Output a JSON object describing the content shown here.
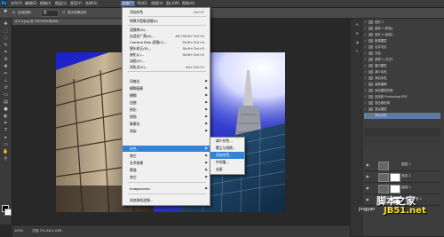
{
  "menubar": {
    "logo": "Ps",
    "items": [
      "文件(F)",
      "编辑(E)",
      "图像(I)",
      "图层(L)",
      "类型(Y)",
      "选择(S)",
      "滤镜(T)",
      "3D(D)",
      "视图(V)",
      "窗口(W)",
      "帮助(H)"
    ],
    "active_index": 6
  },
  "options": {
    "auto_select": "自动选择：",
    "auto_select_value": "组",
    "show_transform": "显示变换控件"
  },
  "document": {
    "tab_title": "4.2.2.jpg @ 100%(RGB/8#)",
    "zoom": "100%",
    "doc_size": "文档:791.4K/1.03M"
  },
  "filter_menu": {
    "items": [
      {
        "label": "添加杂色",
        "shortcut": "Ctrl+F"
      },
      {
        "sep": true
      },
      {
        "label": "转换为智能滤镜(S)",
        "shortcut": ""
      },
      {
        "sep": true
      },
      {
        "label": "滤镜库(G)...",
        "shortcut": ""
      },
      {
        "label": "自适应广角(A)...",
        "shortcut": "Alt+Shift+Ctrl+A"
      },
      {
        "label": "Camera Raw 滤镜(C)...",
        "shortcut": "Shift+Ctrl+A"
      },
      {
        "label": "镜头校正(R)...",
        "shortcut": "Shift+Ctrl+R"
      },
      {
        "label": "液化(L)...",
        "shortcut": "Shift+Ctrl+X"
      },
      {
        "label": "油画(O)...",
        "shortcut": ""
      },
      {
        "label": "消失点(V)...",
        "shortcut": "Alt+Ctrl+V"
      },
      {
        "sep": true
      },
      {
        "label": "风格化",
        "submenu": true
      },
      {
        "label": "模糊画廊",
        "submenu": true
      },
      {
        "label": "模糊",
        "submenu": true
      },
      {
        "label": "扭曲",
        "submenu": true
      },
      {
        "label": "锐化",
        "submenu": true
      },
      {
        "label": "视频",
        "submenu": true
      },
      {
        "label": "像素化",
        "submenu": true
      },
      {
        "label": "渲染",
        "submenu": true
      },
      {
        "label": "杂色",
        "submenu": true,
        "highlight": true
      },
      {
        "label": "其它",
        "submenu": true
      },
      {
        "label": "艺术效果",
        "submenu": true
      },
      {
        "label": "素描",
        "submenu": true
      },
      {
        "label": "其它",
        "submenu": true
      },
      {
        "sep": true
      },
      {
        "label": "Imagenomic",
        "submenu": true
      },
      {
        "sep": true
      },
      {
        "label": "浏览联机滤镜...",
        "shortcut": ""
      }
    ]
  },
  "noise_submenu": {
    "items": [
      {
        "label": "减少杂色..."
      },
      {
        "label": "蒙尘与划痕..."
      },
      {
        "label": "添加杂色...",
        "highlight": true
      },
      {
        "label": "中间值..."
      },
      {
        "label": "去斑"
      }
    ]
  },
  "history": {
    "items": [
      {
        "label": "色阶 1"
      },
      {
        "label": "曲线 1 (颜色)"
      },
      {
        "label": "色阶 2 (曲线)"
      },
      {
        "label": "新建图层"
      },
      {
        "label": "合并可见"
      },
      {
        "label": "去色"
      },
      {
        "label": "滤镜 1 (文字)"
      },
      {
        "label": "盖印图层"
      },
      {
        "label": "减少杂色"
      },
      {
        "label": "添加杂色"
      },
      {
        "label": "高斯模糊"
      },
      {
        "label": "添加图层蒙版"
      },
      {
        "label": "应用到 Photoshop PDF"
      },
      {
        "label": "混合颜色带"
      },
      {
        "label": "混合图层"
      },
      {
        "label": "添加杂色",
        "selected": true
      }
    ]
  },
  "layers": {
    "items": [
      {
        "label": "图层 1"
      },
      {
        "label": "渐变 2"
      },
      {
        "label": "曲线 1"
      },
      {
        "label": "亮度/对比度 1"
      }
    ]
  },
  "watermark": {
    "brand": "脚本之家",
    "url": "jingyan",
    "site": "JB51.net"
  }
}
